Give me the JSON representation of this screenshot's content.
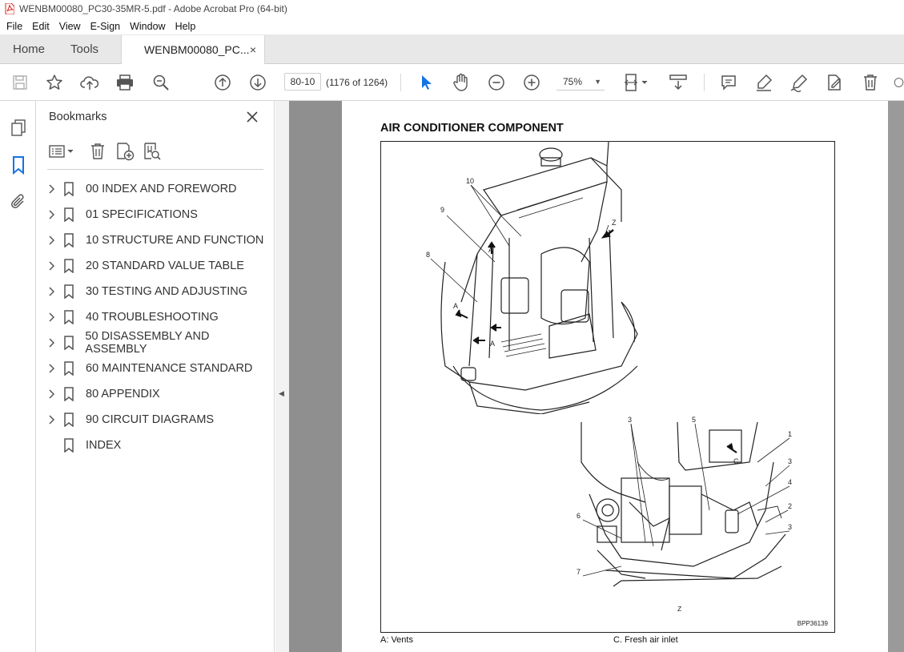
{
  "window": {
    "title": "WENBM00080_PC30-35MR-5.pdf - Adobe Acrobat Pro (64-bit)"
  },
  "menu": [
    "File",
    "Edit",
    "View",
    "E-Sign",
    "Window",
    "Help"
  ],
  "tabs": {
    "home": "Home",
    "tools": "Tools",
    "document": "WENBM00080_PC...",
    "close": "×"
  },
  "toolbar": {
    "page_value": "80-10",
    "page_count": "(1176 of 1264)",
    "zoom": "75%",
    "icons": [
      "save-icon",
      "star-icon",
      "upload-icon",
      "print-icon",
      "find-icon",
      "page-up-icon",
      "page-down-icon",
      "select-arrow-icon",
      "hand-icon",
      "zoom-out-icon",
      "zoom-in-icon",
      "fit-page-icon",
      "scroll-mode-icon",
      "comment-icon",
      "highlight-icon",
      "sign-icon",
      "edit-icon",
      "delete-icon"
    ]
  },
  "bookmarks": {
    "header": "Bookmarks",
    "items": [
      {
        "label": "00 INDEX AND FOREWORD",
        "expandable": true
      },
      {
        "label": "01 SPECIFICATIONS",
        "expandable": true
      },
      {
        "label": "10 STRUCTURE AND FUNCTION",
        "expandable": true
      },
      {
        "label": "20 STANDARD VALUE TABLE",
        "expandable": true
      },
      {
        "label": "30 TESTING AND ADJUSTING",
        "expandable": true
      },
      {
        "label": "40 TROUBLESHOOTING",
        "expandable": true
      },
      {
        "label": "50 DISASSEMBLY AND ASSEMBLY",
        "expandable": true
      },
      {
        "label": "60 MAINTENANCE STANDARD",
        "expandable": true
      },
      {
        "label": "80 APPENDIX",
        "expandable": true
      },
      {
        "label": "90 CIRCUIT DIAGRAMS",
        "expandable": true
      },
      {
        "label": "INDEX",
        "expandable": false
      }
    ]
  },
  "page": {
    "title": "AIR CONDITIONER COMPONENT",
    "figure_code": "BPP36139",
    "callouts_top": [
      "10",
      "9",
      "8",
      "A",
      "A",
      "A",
      "Z"
    ],
    "callouts_bottom": [
      "3",
      "5",
      "1",
      "3",
      "4",
      "2",
      "3",
      "6",
      "7",
      "C",
      "Z"
    ],
    "caption_left": "A: Vents",
    "caption_right": "C. Fresh air inlet"
  },
  "colors": {
    "accent_blue": "#1473e6",
    "doc_bg": "#8f8f8f",
    "pdf_red": "#d9241b"
  }
}
